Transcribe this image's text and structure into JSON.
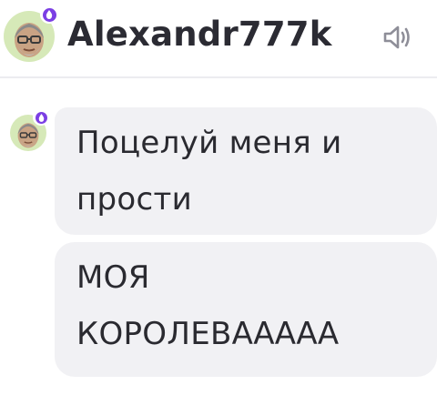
{
  "chat": {
    "username": "Alexandr777k",
    "online_color": "#7b3fe4"
  },
  "header": {
    "avatar_icon": "user-avatar",
    "sound_icon": "speaker-volume-icon"
  },
  "messages": [
    {
      "text": "Поцелуй меня и прости"
    },
    {
      "text": "МОЯ КОРОЛЕВААААА"
    }
  ]
}
